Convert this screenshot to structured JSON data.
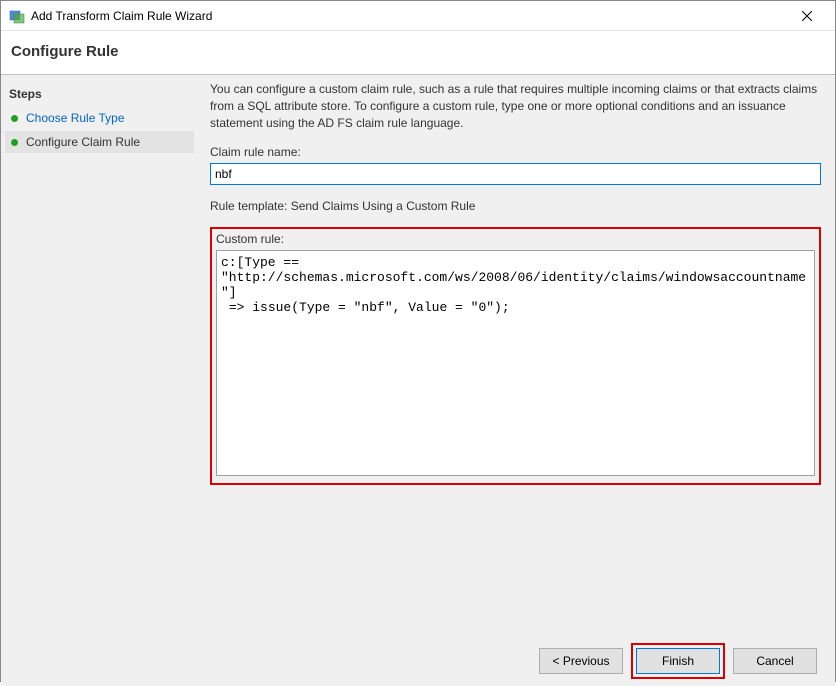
{
  "window": {
    "title": "Add Transform Claim Rule Wizard"
  },
  "header": {
    "title": "Configure Rule"
  },
  "sidebar": {
    "heading": "Steps",
    "items": [
      {
        "label": "Choose Rule Type"
      },
      {
        "label": "Configure Claim Rule"
      }
    ]
  },
  "main": {
    "intro": "You can configure a custom claim rule, such as a rule that requires multiple incoming claims or that extracts claims from a SQL attribute store. To configure a custom rule, type one or more optional conditions and an issuance statement using the AD FS claim rule language.",
    "claim_rule_name_label": "Claim rule name:",
    "claim_rule_name_value": "nbf",
    "rule_template_text": "Rule template: Send Claims Using a Custom Rule",
    "custom_rule_label": "Custom rule:",
    "custom_rule_value": "c:[Type == \"http://schemas.microsoft.com/ws/2008/06/identity/claims/windowsaccountname\"]\n => issue(Type = \"nbf\", Value = \"0\");"
  },
  "buttons": {
    "previous": "< Previous",
    "finish": "Finish",
    "cancel": "Cancel"
  }
}
